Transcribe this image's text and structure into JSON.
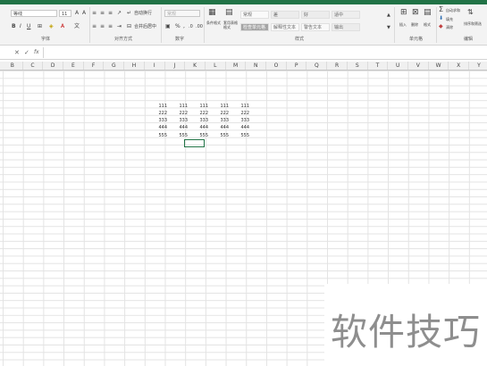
{
  "ribbon": {
    "font_name": "等线",
    "font_size": "11",
    "number_format": "常规",
    "groups": [
      "字体",
      "对齐方式",
      "数字",
      "样式",
      "单元格",
      "编辑"
    ],
    "alignment": {
      "wrap_label": "自动换行",
      "merge_label": "合并后居中"
    },
    "styles": {
      "conditional_label": "条件格式",
      "table_label": "套用表格格式",
      "cell_styles_top": [
        "常规",
        "差",
        "好",
        "适中"
      ],
      "cell_styles_bottom": [
        "检查单元格",
        "解释性文本",
        "警告文本",
        "输出"
      ],
      "check_cell": "检查单元格"
    },
    "cells": {
      "insert": "插入",
      "delete": "删除",
      "format": "格式"
    },
    "editing": {
      "autosum": "自动求和",
      "fill": "填充",
      "clear": "清除",
      "sort_filter": "排序和筛选",
      "find_select": "查找和选择"
    }
  },
  "formula_bar": {
    "cancel": "✕",
    "enter": "✓",
    "fx": "fx",
    "value": ""
  },
  "columns": [
    "B",
    "C",
    "D",
    "E",
    "F",
    "G",
    "H",
    "I",
    "J",
    "K",
    "L",
    "M",
    "N",
    "O",
    "P",
    "Q",
    "R",
    "S",
    "T",
    "U",
    "V",
    "W",
    "X",
    "Y"
  ],
  "sheet": {
    "rows": [
      [
        "111",
        "111",
        "111",
        "111",
        "111"
      ],
      [
        "222",
        "222",
        "222",
        "222",
        "222"
      ],
      [
        "333",
        "333",
        "333",
        "333",
        "333"
      ],
      [
        "444",
        "444",
        "444",
        "444",
        "444"
      ],
      [
        "555",
        "555",
        "555",
        "555",
        "555"
      ]
    ]
  },
  "watermark": "软件技巧"
}
